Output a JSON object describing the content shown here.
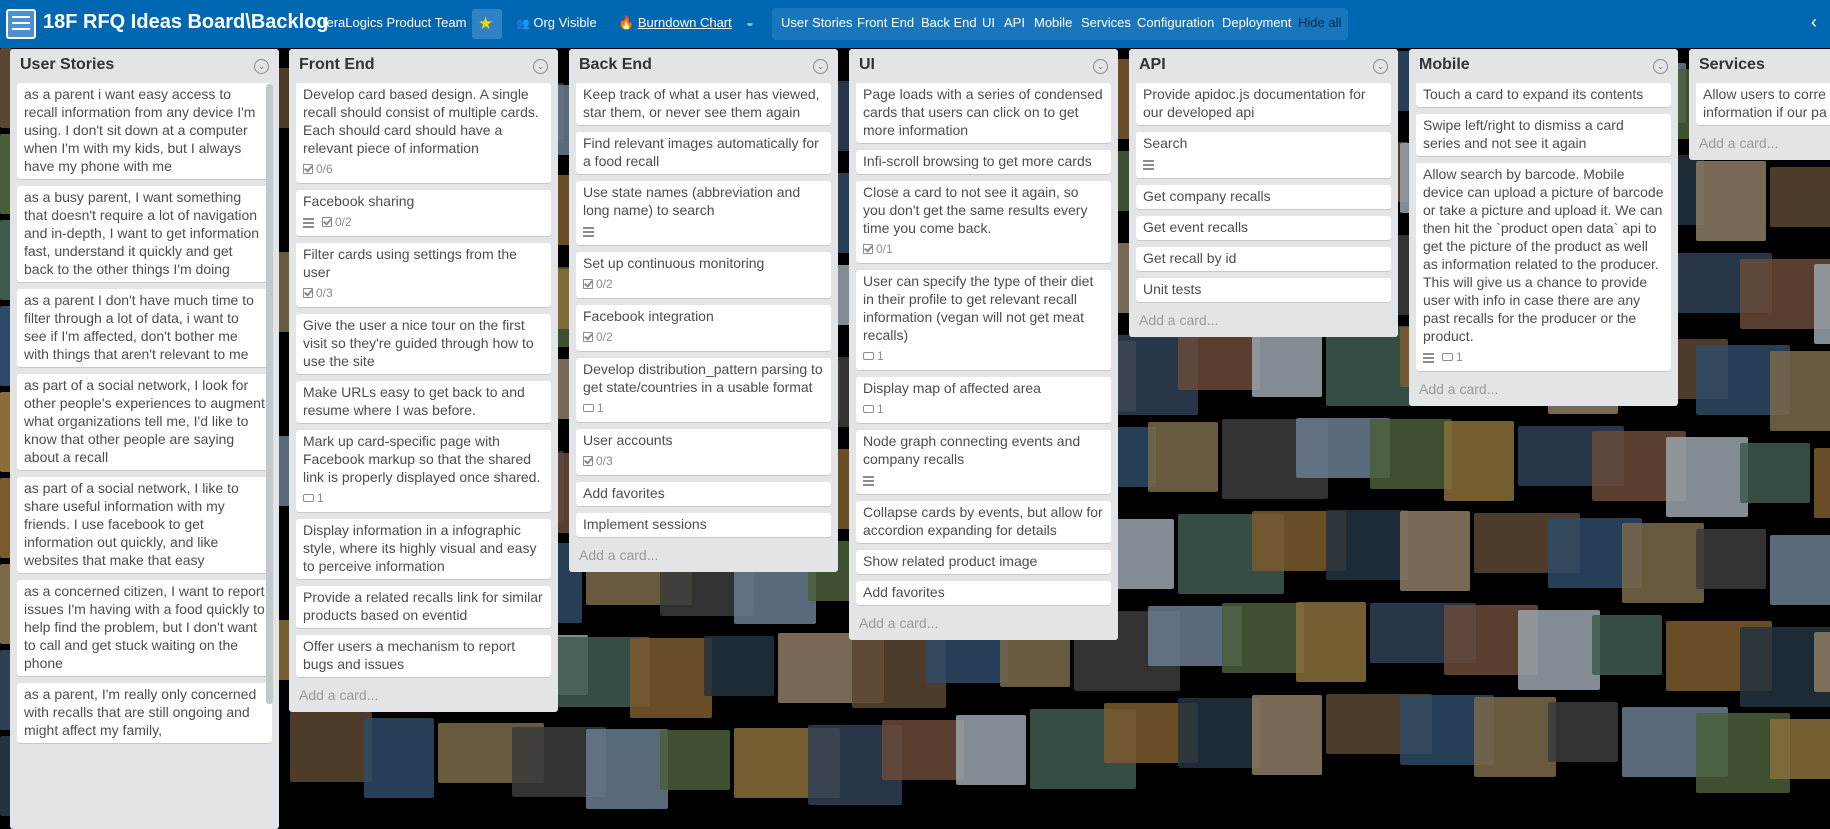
{
  "header": {
    "board_name": "18F RFQ Ideas Board\\Backlog",
    "team": "TeraLogics Product Team",
    "star_icon": "★",
    "org_visible": "Org Visible",
    "burndown": "Burndown Chart",
    "nav": [
      "User Stories",
      "Front End",
      "Back End",
      "UI",
      "API",
      "Mobile",
      "Services",
      "Configuration",
      "Deployment"
    ],
    "hide_all": "Hide all",
    "back_icon": "‹",
    "accent": "#0067b3"
  },
  "lists": [
    {
      "title": "User Stories",
      "cards": [
        {
          "text": "as a parent i want easy access to recall information from any device I'm using. I don't sit down at a computer when I'm with my kids, but I always have my phone with me"
        },
        {
          "text": "as a busy parent, I want something that doesn't require a lot of navigation and in-depth, I want to get information fast, understand it quickly and get back to the other things I'm doing"
        },
        {
          "text": "as a parent I don't have much time to filter through a lot of data, i want to see if I'm affected, don't bother me with things that aren't relevant to me"
        },
        {
          "text": "as part of a social network, I look for other people's experiences to augment what organizations tell me, I'd like to know that other people are saying about a recall"
        },
        {
          "text": "as part of a social network, I like to share useful information with my friends. I use facebook to get information out quickly, and like websites that make that easy"
        },
        {
          "text": "as a concerned citizen, I want to report issues I'm having with a food quickly to help find the problem, but I don't want to call and get stuck waiting on the phone"
        },
        {
          "text": "as a parent, I'm really only concerned with recalls that are still ongoing and might affect my family,"
        }
      ],
      "add": ""
    },
    {
      "title": "Front End",
      "cards": [
        {
          "text": "Develop card based design. A single recall should consist of multiple cards. Each should card should have a relevant piece of information",
          "checklist": "0/6"
        },
        {
          "text": "Facebook sharing",
          "desc": true,
          "checklist": "0/2"
        },
        {
          "text": "Filter cards using settings from the user",
          "checklist": "0/3"
        },
        {
          "text": "Give the user a nice tour on the first visit so they're guided through how to use the site"
        },
        {
          "text": "Make URLs easy to get back to and resume where I was before."
        },
        {
          "text": "Mark up card-specific page with Facebook markup so that the shared link is properly displayed once shared.",
          "comments": "1"
        },
        {
          "text": "Display information in a infographic style, where its highly visual and easy to perceive information"
        },
        {
          "text": "Provide a related recalls link for similar products based on eventid"
        },
        {
          "text": "Offer users a mechanism to report bugs and issues"
        }
      ],
      "add": "Add a card..."
    },
    {
      "title": "Back End",
      "cards": [
        {
          "text": "Keep track of what a user has viewed, star them, or never see them again"
        },
        {
          "text": "Find relevant images automatically for a food recall"
        },
        {
          "text": "Use state names (abbreviation and long name) to search",
          "desc": true
        },
        {
          "text": "Set up continuous monitoring",
          "checklist": "0/2"
        },
        {
          "text": "Facebook integration",
          "checklist": "0/2"
        },
        {
          "text": "Develop distribution_pattern parsing to get state/countries in a usable format",
          "comments": "1"
        },
        {
          "text": "User accounts",
          "checklist": "0/3"
        },
        {
          "text": "Add favorites"
        },
        {
          "text": "Implement sessions"
        }
      ],
      "add": "Add a card..."
    },
    {
      "title": "UI",
      "cards": [
        {
          "text": "Page loads with a series of condensed cards that users can click on to get more information"
        },
        {
          "text": "Infi-scroll browsing to get more cards"
        },
        {
          "text": "Close a card to not see it again, so you don't get the same results every time you come back.",
          "checklist": "0/1"
        },
        {
          "text": "User can specify the type of their diet in their profile to get relevant recall information (vegan will not get meat recalls)",
          "comments": "1"
        },
        {
          "text": "Display map of affected area",
          "comments": "1"
        },
        {
          "text": "Node graph connecting events and company recalls",
          "desc": true
        },
        {
          "text": "Collapse cards by events, but allow for accordion expanding for details"
        },
        {
          "text": "Show related product image"
        },
        {
          "text": "Add favorites"
        }
      ],
      "add": "Add a card..."
    },
    {
      "title": "API",
      "cards": [
        {
          "text": "Provide apidoc.js documentation for our developed api"
        },
        {
          "text": "Search",
          "desc": true
        },
        {
          "text": "Get company recalls"
        },
        {
          "text": "Get event recalls"
        },
        {
          "text": "Get recall by id"
        },
        {
          "text": "Unit tests"
        }
      ],
      "add": "Add a card..."
    },
    {
      "title": "Mobile",
      "cards": [
        {
          "text": "Touch a card to expand its contents"
        },
        {
          "text": "Swipe left/right to dismiss a card series and not see it again"
        },
        {
          "text": "Allow search by barcode. Mobile device can upload a picture of barcode or take a picture and upload it. We can then hit the `product open data` api to get the picture of the product as well as information related to the producer. This will give us a chance to provide user with info in case there are any past recalls for the producer or the product.",
          "desc": true,
          "comments": "1"
        }
      ],
      "add": "Add a card..."
    },
    {
      "title": "Services",
      "cards": [
        {
          "text": "Allow users to corre information if our pa"
        }
      ],
      "add": "Add a card..."
    }
  ]
}
